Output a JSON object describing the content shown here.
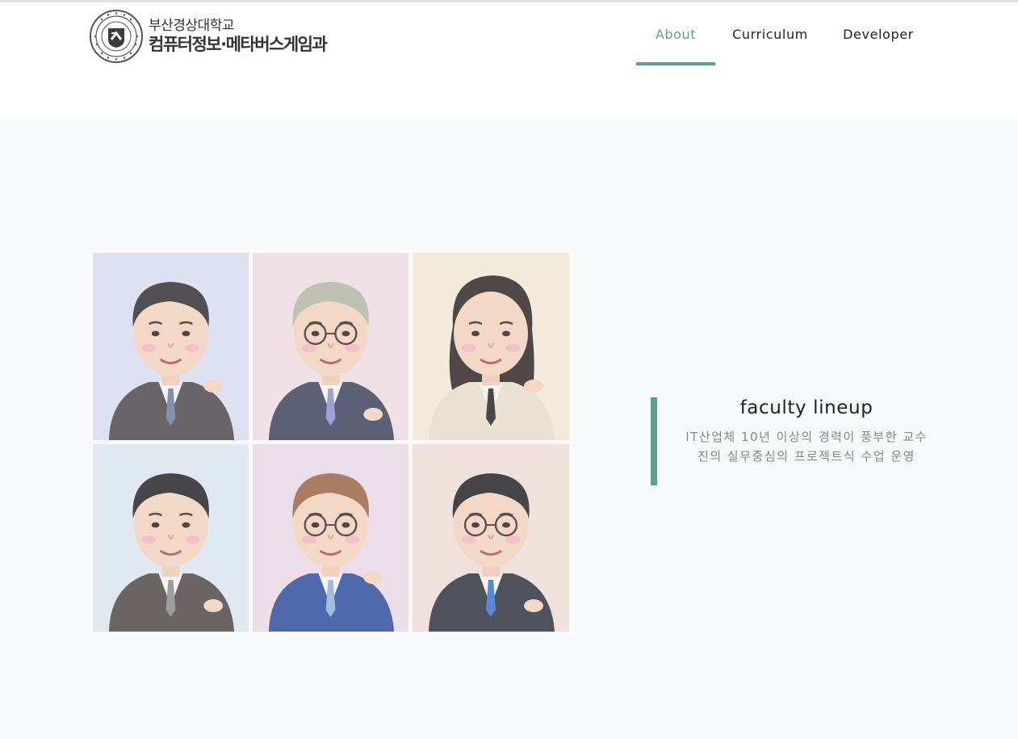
{
  "header": {
    "logo": {
      "university_name": "부산경상대학교",
      "department_name": "컴퓨터정보·메타버스게임과",
      "seal_text": "BUSAN KYUNGSANG COLLEGE"
    },
    "nav": [
      {
        "label": "About",
        "active": true
      },
      {
        "label": "Curriculum",
        "active": false
      },
      {
        "label": "Developer",
        "active": false
      }
    ]
  },
  "colors": {
    "accent": "#5a9e98",
    "section_bg": "#f7f8fa",
    "text": "#222222",
    "muted_text": "#888888"
  },
  "faculty": {
    "title": "faculty lineup",
    "description": "IT산업체 10년 이상의 경력이 풍부한 교수진의 실무중심의 프로젝트식 수업 운영",
    "portraits": [
      {
        "label": "faculty-caricature-1",
        "bg": "#d9dcf0",
        "hair": "#2e2b2e",
        "suit": "#4a4449",
        "tie": "#6a7a9a"
      },
      {
        "label": "faculty-caricature-2",
        "bg": "#efdce3",
        "hair": "#b5b5a6",
        "suit": "#3a3f5a",
        "tie": "#8a8fd0"
      },
      {
        "label": "faculty-caricature-3",
        "bg": "#f4e8d4",
        "hair": "#2a2222",
        "suit": "#e8dcc8",
        "tie": "#222222"
      },
      {
        "label": "faculty-caricature-4",
        "bg": "#dce6f0",
        "hair": "#1f1f24",
        "suit": "#4d4445",
        "tie": "#8a8a8a"
      },
      {
        "label": "faculty-caricature-5",
        "bg": "#ead9e6",
        "hair": "#9a6240",
        "suit": "#2b4a9a",
        "tie": "#8fb0d8"
      },
      {
        "label": "faculty-caricature-6",
        "bg": "#f0dcd6",
        "hair": "#1f1f22",
        "suit": "#2b2d3a",
        "tie": "#3a6fd0"
      }
    ]
  }
}
